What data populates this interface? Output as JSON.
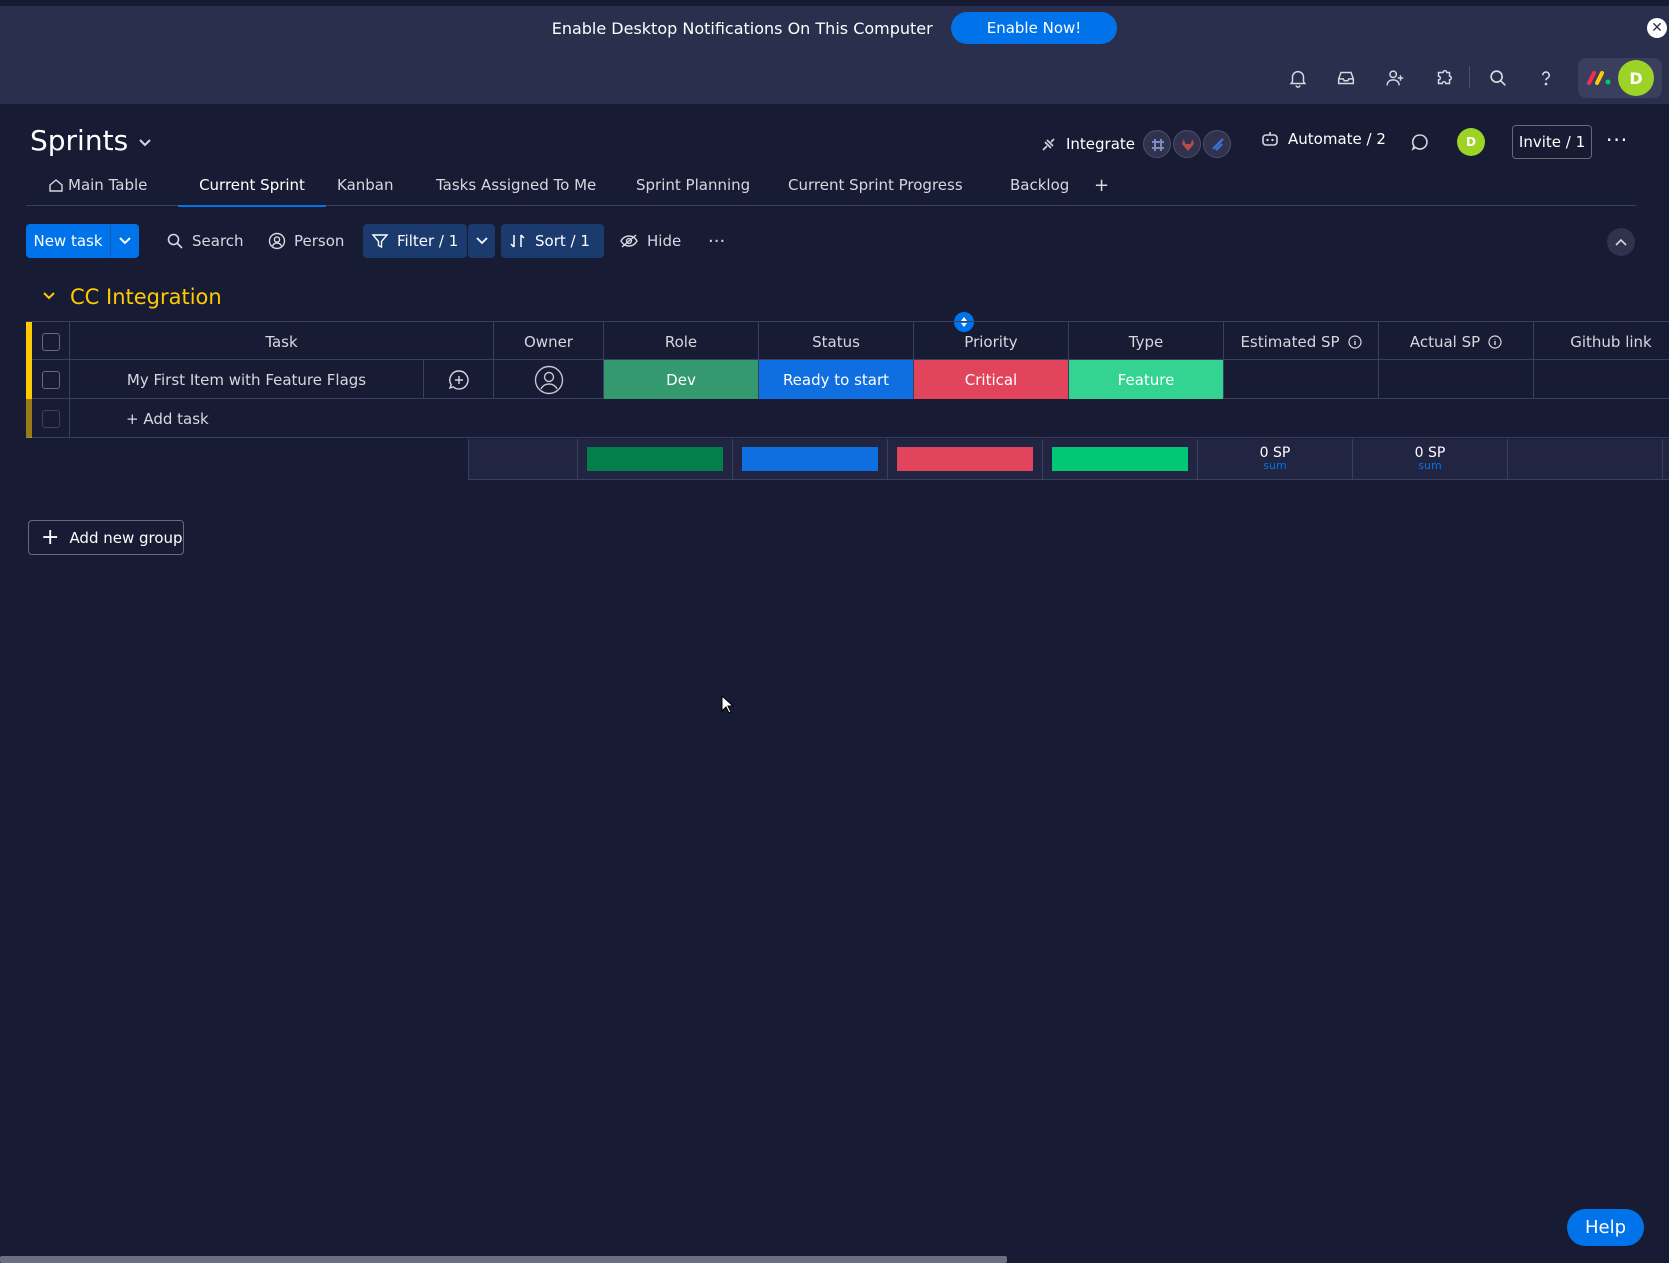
{
  "notification": {
    "message": "Enable Desktop Notifications On This Computer",
    "button": "Enable Now!",
    "close_glyph": "✕"
  },
  "header_icons": [
    "bell-icon",
    "inbox-icon",
    "invite-members-icon",
    "apps-icon",
    "search-icon",
    "help-icon"
  ],
  "user": {
    "avatar_initial": "D",
    "avatar_color": "#9cd326"
  },
  "board": {
    "title": "Sprints",
    "integrate_label": "Integrate",
    "automate_label": "Automate / 2",
    "invite_label": "Invite / 1",
    "more_glyph": "···",
    "avatar_initial": "D"
  },
  "tabs": [
    {
      "label": "Main Table",
      "icon": "home-icon"
    },
    {
      "label": "Current Sprint",
      "active": true
    },
    {
      "label": "Kanban"
    },
    {
      "label": "Tasks Assigned To Me"
    },
    {
      "label": "Sprint Planning"
    },
    {
      "label": "Current Sprint Progress"
    },
    {
      "label": "Backlog"
    },
    {
      "label": "+"
    }
  ],
  "toolbar": {
    "new_task": "New task",
    "search": "Search",
    "person": "Person",
    "filter": "Filter / 1",
    "sort": "Sort / 1",
    "hide": "Hide",
    "more_glyph": "···"
  },
  "group": {
    "title": "CC Integration",
    "color": "#ffcb00",
    "columns": [
      "Task",
      "Owner",
      "Role",
      "Status",
      "Priority",
      "Type",
      "Estimated SP",
      "Actual SP",
      "Github link"
    ],
    "rows": [
      {
        "task": "My First Item with Feature Flags",
        "role": {
          "label": "Dev",
          "color": "#359970"
        },
        "status": {
          "label": "Ready to start",
          "color": "#0f6ee0"
        },
        "priority": {
          "label": "Critical",
          "color": "#e2445c"
        },
        "type": {
          "label": "Feature",
          "color": "#33d391"
        }
      }
    ],
    "add_task": "+ Add task",
    "summary": {
      "role_color": "#037f4c",
      "status_color": "#0f6ee0",
      "priority_color": "#e2445c",
      "type_color": "#00c875",
      "estimated_sp": "0 SP",
      "estimated_sub": "sum",
      "actual_sp": "0 SP",
      "actual_sub": "sum"
    }
  },
  "add_group": "Add new group",
  "help": "Help"
}
